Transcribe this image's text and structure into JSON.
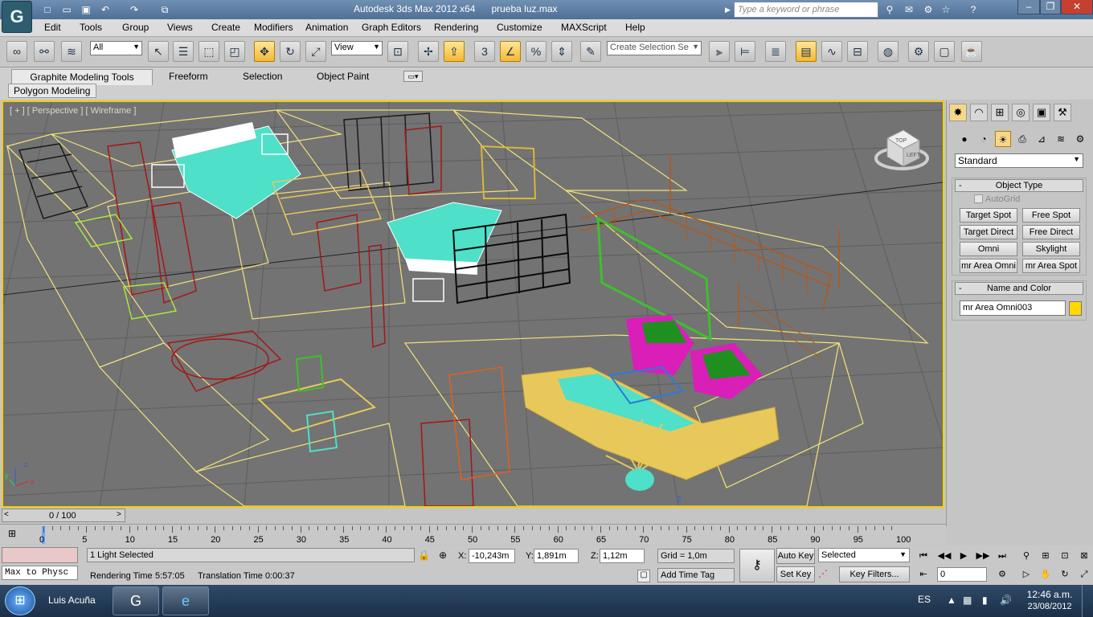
{
  "titlebar": {
    "app_title": "Autodesk 3ds Max  2012 x64",
    "file_name": "prueba luz.max",
    "search_placeholder": "Type a keyword or phrase",
    "app_logo": "3ds-max-logo-icon",
    "minimize": "–",
    "maximize": "❐",
    "close": "✕"
  },
  "menu": [
    "Edit",
    "Tools",
    "Group",
    "Views",
    "Create",
    "Modifiers",
    "Animation",
    "Graph Editors",
    "Rendering",
    "Customize",
    "MAXScript",
    "Help"
  ],
  "toolbar": {
    "selection_filter": "All",
    "ref_coord": "View",
    "named_selection_placeholder": "Create Selection Se",
    "snap_label": "3"
  },
  "ribbon": {
    "tabs": [
      "Graphite Modeling Tools",
      "Freeform",
      "Selection",
      "Object Paint"
    ],
    "panel": "Polygon Modeling"
  },
  "viewport": {
    "label": "[ + ] [ Perspective ] [ Wireframe ]",
    "viewcube_labels": [
      "TOP",
      "LEFT"
    ],
    "axis_labels": [
      "x",
      "y",
      "z"
    ],
    "marker": "2",
    "border_color": "#f2d000"
  },
  "command_panel": {
    "category": "Standard",
    "object_type_title": "Object Type",
    "autogrid": "AutoGrid",
    "buttons": [
      "Target Spot",
      "Free Spot",
      "Target Direct",
      "Free Direct",
      "Omni",
      "Skylight",
      "mr Area Omni",
      "mr Area Spot"
    ],
    "name_color_title": "Name and Color",
    "object_name": "mr Area Omni003",
    "object_color": "#ffd800"
  },
  "timeline": {
    "slider_label": "0 / 100",
    "ticks": [
      "0",
      "5",
      "10",
      "15",
      "20",
      "25",
      "30",
      "35",
      "40",
      "45",
      "50",
      "55",
      "60",
      "65",
      "70",
      "75",
      "80",
      "85",
      "90",
      "95",
      "100"
    ]
  },
  "status": {
    "maxscript_listener": "Max to Physc",
    "selection_info": "1 Light Selected",
    "render_time_label": "Rendering Time",
    "render_time": "5:57:05",
    "translation_time_label": "Translation Time",
    "translation_time": "0:00:37",
    "x_label": "X:",
    "x_value": "-10,243m",
    "y_label": "Y:",
    "y_value": "1,891m",
    "z_label": "Z:",
    "z_value": "1,12m",
    "grid": "Grid = 1,0m",
    "add_time_tag": "Add Time Tag",
    "auto_key": "Auto Key",
    "set_key": "Set Key",
    "key_mode": "Selected",
    "key_filters": "Key Filters...",
    "frame": "0"
  },
  "taskbar": {
    "user": "Luis Acuña",
    "language": "ES",
    "time": "12:46 a.m.",
    "date": "23/08/2012"
  }
}
